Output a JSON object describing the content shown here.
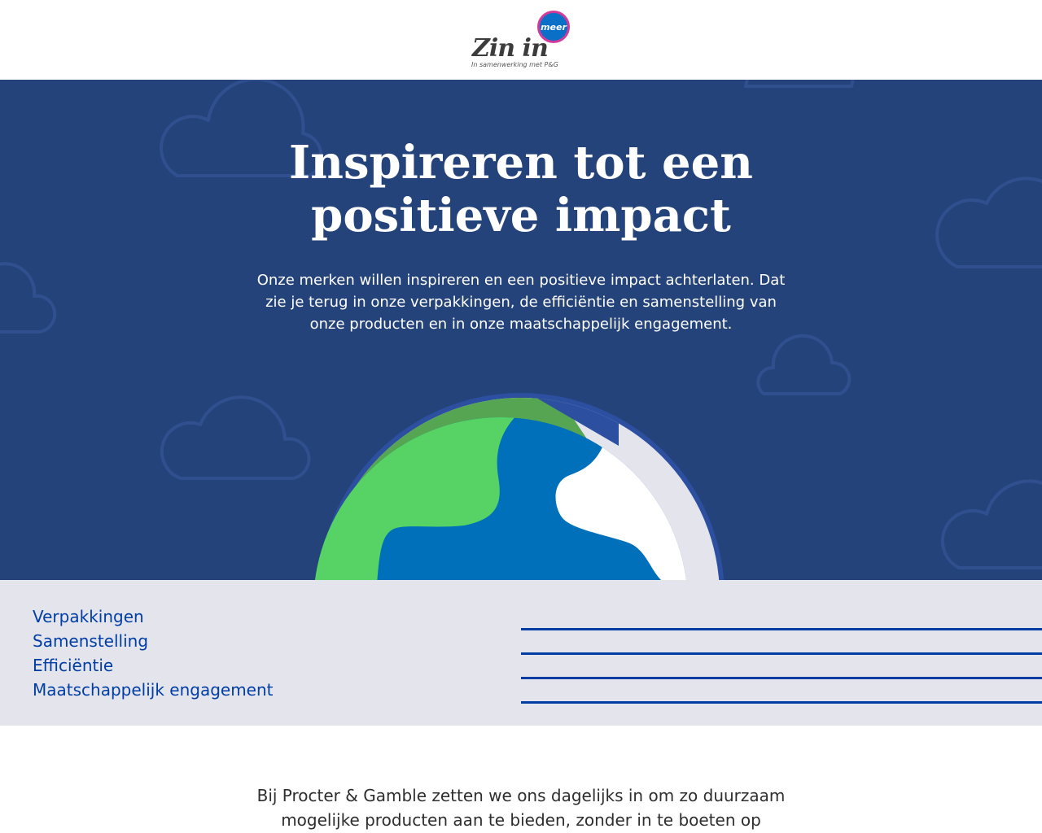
{
  "header": {
    "logo_main": "Zin in",
    "logo_bubble": "meer",
    "logo_sub": "In samenwerking met P&G"
  },
  "hero": {
    "title": "Inspireren tot een positieve impact",
    "text": "Onze merken willen inspireren en een positieve impact achterlaten. Dat zie je terug in onze verpakkingen, de efficiëntie en samenstelling van onze producten en in onze maatschappelijk engagement.",
    "colors": {
      "background": "#25437b",
      "cloud_outline": "#2f4f8f",
      "land": "#56d364",
      "land_dark": "#55a552",
      "ocean": "#0070bb",
      "ice": "#ffffff",
      "atmosphere": "#e4e5ec",
      "globe_ring": "#2c4fa0"
    }
  },
  "nav": {
    "items": [
      {
        "label": "Verpakkingen"
      },
      {
        "label": "Samenstelling"
      },
      {
        "label": "Efficiëntie"
      },
      {
        "label": "Maatschappelijk engagement"
      }
    ],
    "colors": {
      "background": "#e4e5ec",
      "link": "#003da5"
    }
  },
  "intro": {
    "text": "Bij Procter & Gamble zetten we ons dagelijks in om zo duurzaam mogelijke producten aan te bieden, zonder in te boeten op"
  }
}
